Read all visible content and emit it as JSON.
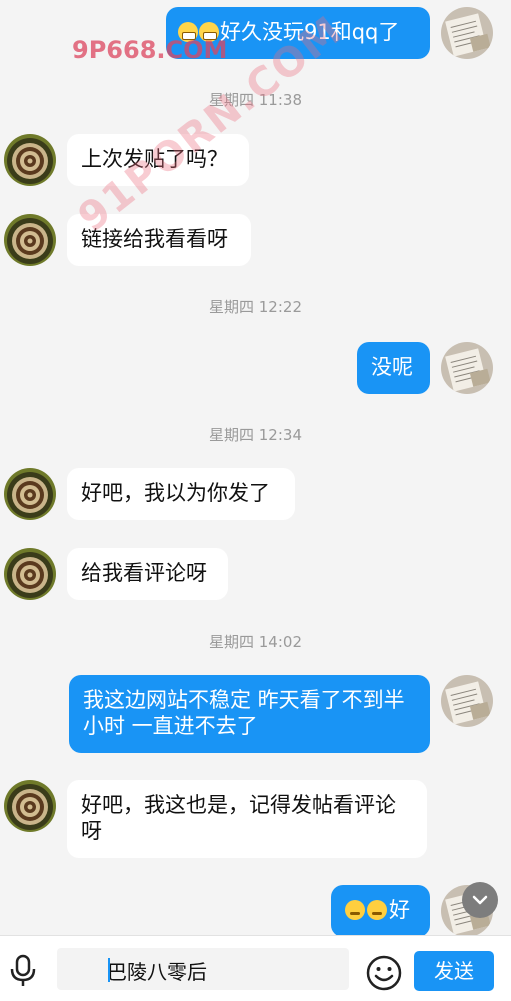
{
  "watermarks": {
    "top": "9P668.COM",
    "diagonal": "91PORN.COM"
  },
  "messages": [
    {
      "type": "out",
      "text": "好久没玩91和qq了",
      "emojis": [
        "grin-emoji",
        "grin-emoji"
      ]
    },
    {
      "type": "time",
      "text": "星期四 11:38"
    },
    {
      "type": "in",
      "text": "上次发贴了吗？"
    },
    {
      "type": "in",
      "text": "链接给我看看呀"
    },
    {
      "type": "time",
      "text": "星期四 12:22"
    },
    {
      "type": "out",
      "text": "没呢"
    },
    {
      "type": "time",
      "text": "星期四 12:34"
    },
    {
      "type": "in",
      "text": "好吧，我以为你发了"
    },
    {
      "type": "in",
      "text": "给我看评论呀"
    },
    {
      "type": "time",
      "text": "星期四 14:02"
    },
    {
      "type": "out",
      "text": "我这边网站不稳定 昨天看了不到半小时 一直进不去了"
    },
    {
      "type": "in",
      "text": "好吧，我这也是，记得发帖看评论呀"
    },
    {
      "type": "out",
      "text": "好",
      "emojis": [
        "thinking-emoji",
        "thinking-emoji"
      ]
    }
  ],
  "input": {
    "value": "巴陵八零后"
  },
  "send_label": "发送",
  "colors": {
    "accent": "#1994f5",
    "background": "#f4f4f4",
    "watermark": "#eb6e7d"
  },
  "icons": [
    "mic-icon",
    "emoji-icon",
    "chevron-down-icon",
    "avatar-coffee",
    "avatar-document"
  ]
}
